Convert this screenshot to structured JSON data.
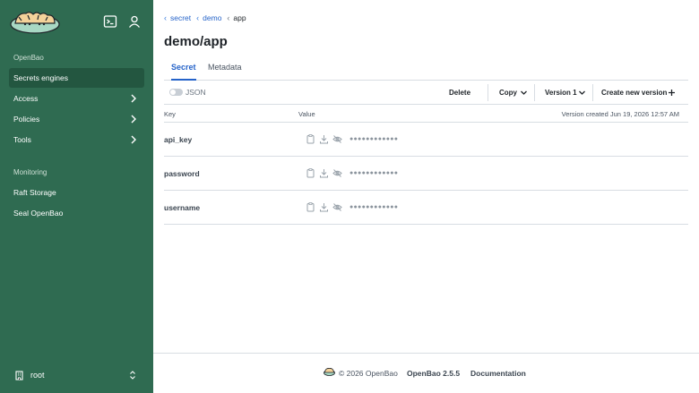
{
  "sidebar": {
    "section_openbao": "OpenBao",
    "items": [
      {
        "label": "Secrets engines"
      },
      {
        "label": "Access"
      },
      {
        "label": "Policies"
      },
      {
        "label": "Tools"
      }
    ],
    "section_monitoring": "Monitoring",
    "monitor_items": [
      {
        "label": "Raft Storage"
      },
      {
        "label": "Seal OpenBao"
      }
    ],
    "user": "root",
    "colors": {
      "background": "#2f6b51",
      "active": "#235640"
    }
  },
  "breadcrumb": {
    "items": [
      "secret",
      "demo"
    ],
    "current": "app"
  },
  "page": {
    "title": "demo/app"
  },
  "tabs": [
    {
      "label": "Secret",
      "active": true
    },
    {
      "label": "Metadata",
      "active": false
    }
  ],
  "toolbar": {
    "json_label": "JSON",
    "delete_label": "Delete",
    "copy_label": "Copy",
    "version_label": "Version 1",
    "create_label": "Create new version"
  },
  "table": {
    "col_key": "Key",
    "col_value": "Value",
    "version_created": "Version created Jun 19, 2026 12:57 AM",
    "rows": [
      {
        "key": "api_key",
        "value": "●●●●●●●●●●●●"
      },
      {
        "key": "password",
        "value": "●●●●●●●●●●●●"
      },
      {
        "key": "username",
        "value": "●●●●●●●●●●●●"
      }
    ]
  },
  "footer": {
    "copyright": "© 2026 OpenBao",
    "version": "OpenBao 2.5.5",
    "docs": "Documentation"
  },
  "accent_color": "#2563c9"
}
